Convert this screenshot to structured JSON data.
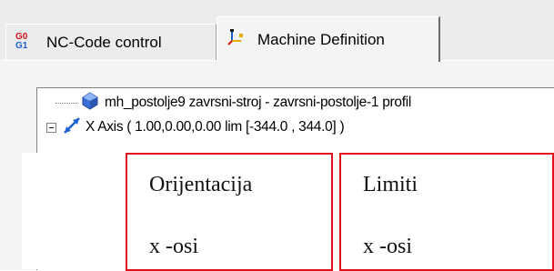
{
  "tabs": [
    {
      "label": "NC-Code control",
      "icon": "gcode-g01-icon",
      "active": false
    },
    {
      "label": "Machine Definition",
      "icon": "machine-axes-icon",
      "active": true
    }
  ],
  "tree": {
    "items": [
      {
        "label": "mh_postolje9 zavrsni-stroj - zavrsni-postolje-1 profil",
        "icon": "machine-model-icon"
      },
      {
        "label": "X Axis ( 1.00,0.00,0.00 lim [-344.0 , 344.0] )",
        "icon": "axis-arrow-icon",
        "expanded": true
      }
    ]
  },
  "annotations": {
    "box1": {
      "title": "Orijentacija",
      "sub": "x -osi"
    },
    "box2": {
      "title": "Limiti",
      "sub": "x -osi"
    }
  },
  "colors": {
    "annotation_border": "#e0131d",
    "panel_bg": "#f4f4f4",
    "tab_bg": "#ececec"
  }
}
